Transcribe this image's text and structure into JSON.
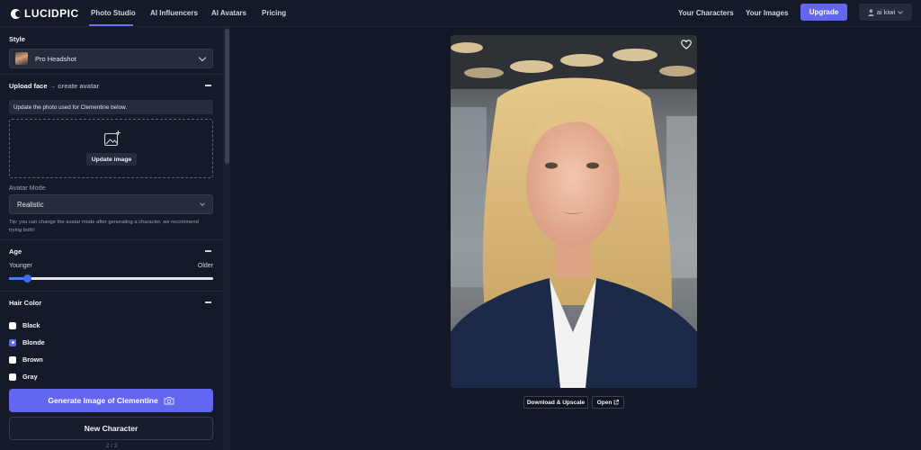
{
  "brand": {
    "name": "LUCIDPIC"
  },
  "nav": {
    "items": [
      "Photo Studio",
      "AI Influencers",
      "AI Avatars",
      "Pricing"
    ],
    "right_links": [
      "Your Characters",
      "Your Images"
    ],
    "upgrade_label": "Upgrade",
    "user_label": "ai kiwi"
  },
  "panel": {
    "style": {
      "title": "Style",
      "selected": "Pro Headshot"
    },
    "upload": {
      "title": "Upload face",
      "subtitle": "→ create avatar",
      "info": "Update the photo used for Clementine below.",
      "button": "Update image"
    },
    "avatar_mode": {
      "label": "Avatar Mode",
      "selected": "Realistic",
      "tip": "Tip: you can change the avatar mode after generating a character, we recommend trying both!"
    },
    "age": {
      "title": "Age",
      "min_label": "Younger",
      "max_label": "Older",
      "value_fraction": 0.09
    },
    "hair": {
      "title": "Hair Color",
      "options": [
        "Black",
        "Blonde",
        "Brown",
        "Gray"
      ],
      "selected": "Blonde"
    },
    "generate_label": "Generate Image of Clementine",
    "new_character_label": "New Character",
    "page_counter": "2 / 3"
  },
  "preview": {
    "download_label": "Download & Upscale",
    "open_label": "Open"
  },
  "colors": {
    "accent": "#6366f1",
    "background": "#121826",
    "panel": "#141a28"
  }
}
